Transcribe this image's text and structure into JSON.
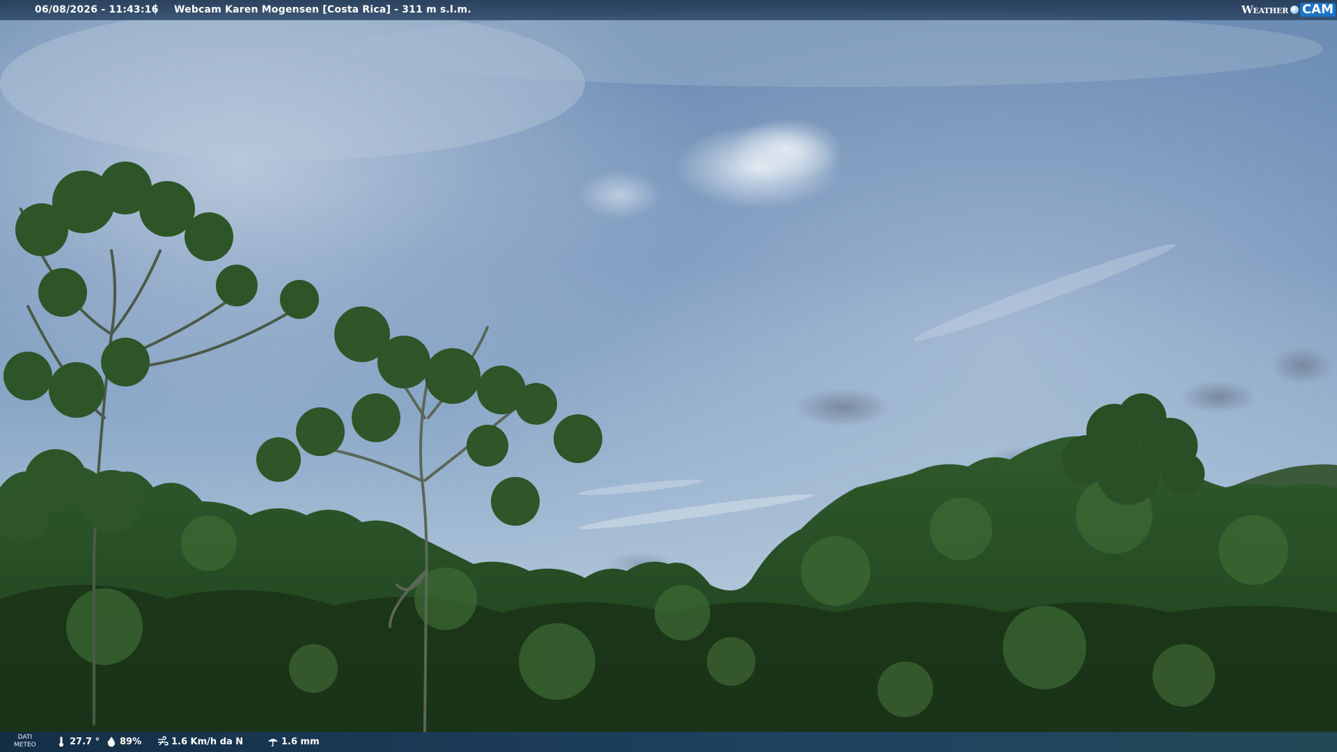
{
  "topbar": {
    "datetime": "06/08/2026 - 11:43:16",
    "separator": "|",
    "title": "Webcam Karen Mogensen [Costa Rica] - 311 m s.l.m."
  },
  "logo": {
    "weather": "Weather",
    "cam": "CAM"
  },
  "weather": {
    "label_line1": "DATI",
    "label_line2": "METEO",
    "temperature": "27.7 °",
    "humidity": "89%",
    "wind": "1.6 Km/h da N",
    "rain": "1.6 mm",
    "icons": {
      "temperature": "thermometer-icon",
      "humidity": "water-drop-icon",
      "wind": "wind-icon",
      "rain": "umbrella-icon"
    }
  },
  "colors": {
    "sky_top": "#5f7fa6",
    "sky_mid": "#7f9dc0",
    "sky_low": "#a9bfd6",
    "forest_dark": "#1f3a1c",
    "forest_mid": "#2f5a28",
    "bar_bg": "#243a56"
  }
}
